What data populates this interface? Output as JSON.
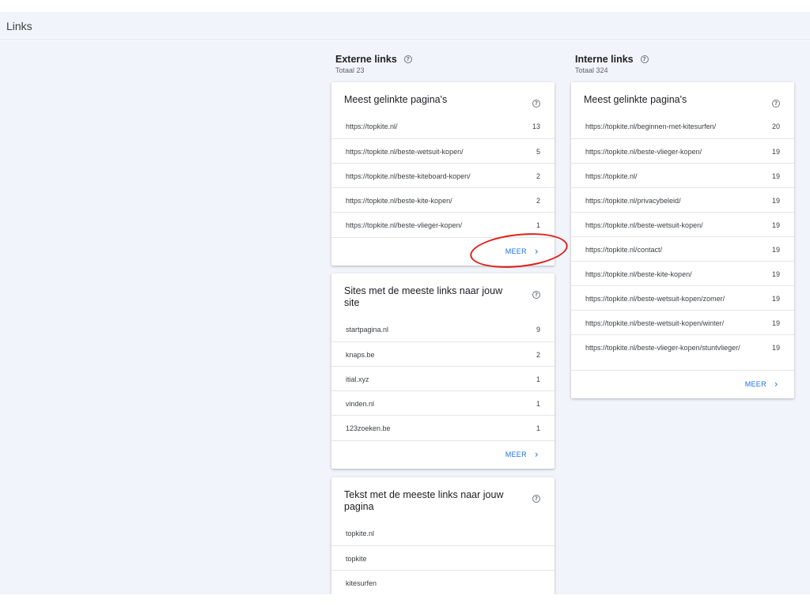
{
  "header": {
    "title": "Links"
  },
  "external": {
    "title": "Externe links",
    "total": "Totaal 23",
    "cards": {
      "top_pages": {
        "title": "Meest gelinkte pagina's",
        "rows": [
          {
            "label": "https://topkite.nl/",
            "count": "13"
          },
          {
            "label": "https://topkite.nl/beste-wetsuit-kopen/",
            "count": "5"
          },
          {
            "label": "https://topkite.nl/beste-kiteboard-kopen/",
            "count": "2"
          },
          {
            "label": "https://topkite.nl/beste-kite-kopen/",
            "count": "2"
          },
          {
            "label": "https://topkite.nl/beste-vlieger-kopen/",
            "count": "1"
          }
        ],
        "more": "MEER"
      },
      "top_sites": {
        "title": "Sites met de meeste links naar jouw site",
        "rows": [
          {
            "label": "startpagina.nl",
            "count": "9"
          },
          {
            "label": "knaps.be",
            "count": "2"
          },
          {
            "label": "itial.xyz",
            "count": "1"
          },
          {
            "label": "vinden.nl",
            "count": "1"
          },
          {
            "label": "123zoeken.be",
            "count": "1"
          }
        ],
        "more": "MEER"
      },
      "top_text": {
        "title": "Tekst met de meeste links naar jouw pagina",
        "rows": [
          {
            "label": "topkite.nl"
          },
          {
            "label": "topkite"
          },
          {
            "label": "kitesurfen"
          }
        ]
      }
    }
  },
  "internal": {
    "title": "Interne links",
    "total": "Totaal 324",
    "cards": {
      "top_pages": {
        "title": "Meest gelinkte pagina's",
        "rows": [
          {
            "label": "https://topkite.nl/beginnen-met-kitesurfen/",
            "count": "20"
          },
          {
            "label": "https://topkite.nl/beste-vlieger-kopen/",
            "count": "19"
          },
          {
            "label": "https://topkite.nl/",
            "count": "19"
          },
          {
            "label": "https://topkite.nl/privacybeleid/",
            "count": "19"
          },
          {
            "label": "https://topkite.nl/beste-wetsuit-kopen/",
            "count": "19"
          },
          {
            "label": "https://topkite.nl/contact/",
            "count": "19"
          },
          {
            "label": "https://topkite.nl/beste-kite-kopen/",
            "count": "19"
          },
          {
            "label": "https://topkite.nl/beste-wetsuit-kopen/zomer/",
            "count": "19"
          },
          {
            "label": "https://topkite.nl/beste-wetsuit-kopen/winter/",
            "count": "19"
          },
          {
            "label": "https://topkite.nl/beste-vlieger-kopen/stuntvlieger/",
            "count": "19"
          }
        ],
        "more": "MEER"
      }
    }
  },
  "icons": {
    "help": "help-circle-icon",
    "chevron": "chevron-right-icon"
  },
  "colors": {
    "accent": "#1a73e8",
    "annotation": "#e0201b",
    "background": "#f1f4fa"
  }
}
